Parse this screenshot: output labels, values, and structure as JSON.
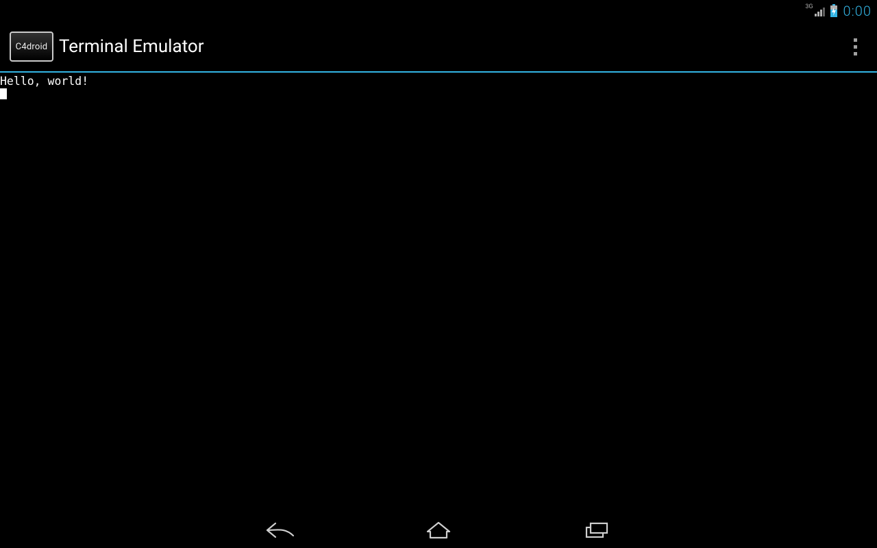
{
  "status_bar": {
    "network_label": "3G",
    "clock": "0:00"
  },
  "action_bar": {
    "app_icon_text": "C4droid",
    "title": "Terminal Emulator"
  },
  "terminal": {
    "output": "Hello, world!"
  }
}
